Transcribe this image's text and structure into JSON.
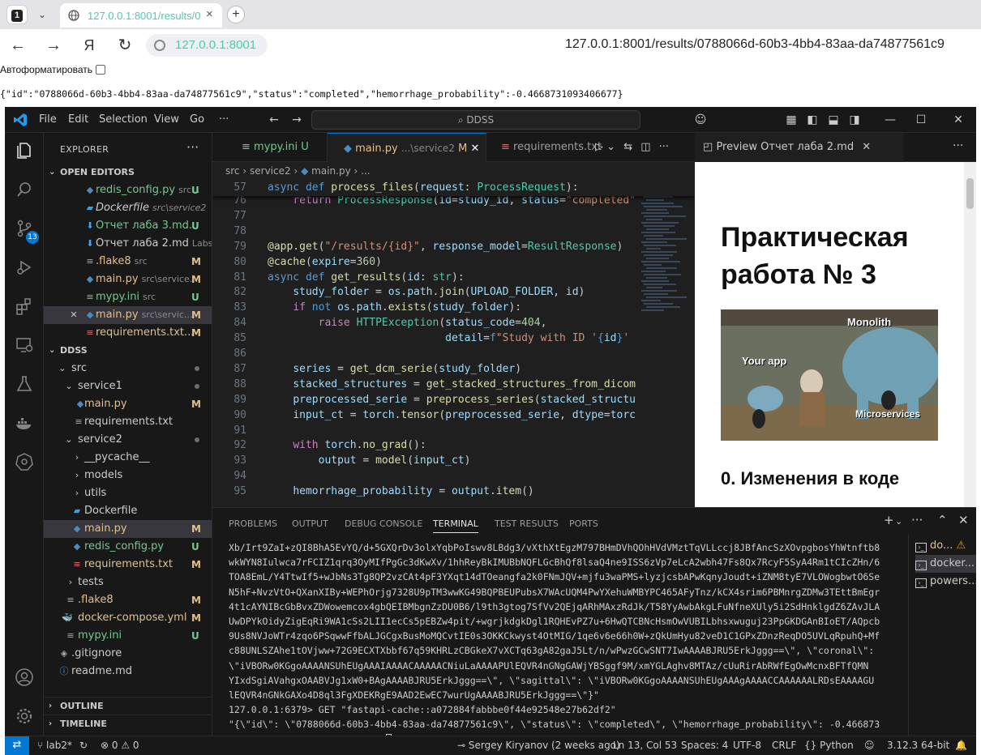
{
  "browser": {
    "tab_count": "1",
    "tab_title": "127.0.0.1:8001/results/0",
    "address_short": "127.0.0.1:8001",
    "full_url": "127.0.0.1:8001/results/0788066d-60b3-4bb4-83aa-da74877561c9",
    "yandex_glyph": "Я"
  },
  "page": {
    "autoformat_label": "Автоформатировать",
    "json_text": "{\"id\":\"0788066d-60b3-4bb4-83aa-da74877561c9\",\"status\":\"completed\",\"hemorrhage_probability\":-0.4668731093406677}"
  },
  "vscode": {
    "menu": [
      "File",
      "Edit",
      "Selection",
      "View",
      "Go",
      "···"
    ],
    "search_text": "DDSS",
    "activity_badge": "13",
    "explorer": {
      "title": "EXPLORER",
      "open_editors_label": "OPEN EDITORS",
      "open_editors": [
        {
          "name": "redis_config.py",
          "sub": "src...",
          "status": "U"
        },
        {
          "name": "Dockerfile",
          "sub": "src\\service2",
          "status": ""
        },
        {
          "name": "Отчет лаба 3.md...",
          "sub": "",
          "status": "U"
        },
        {
          "name": "Отчет лаба 2.md",
          "sub": "Labs\\...",
          "status": ""
        },
        {
          "name": ".flake8",
          "sub": "src",
          "status": "M"
        },
        {
          "name": "main.py",
          "sub": "src\\service...",
          "status": "M"
        },
        {
          "name": "mypy.ini",
          "sub": "src",
          "status": "U"
        },
        {
          "name": "main.py",
          "sub": "src\\servic...",
          "status": "M"
        },
        {
          "name": "requirements.txt...",
          "sub": "",
          "status": "M"
        }
      ],
      "workspace_label": "DDSS",
      "tree": [
        {
          "name": "src",
          "status": ""
        },
        {
          "name": "service1",
          "status": ""
        },
        {
          "name": "main.py",
          "status": "M"
        },
        {
          "name": "requirements.txt",
          "status": ""
        },
        {
          "name": "service2",
          "status": ""
        },
        {
          "name": "__pycache__",
          "status": ""
        },
        {
          "name": "models",
          "status": ""
        },
        {
          "name": "utils",
          "status": ""
        },
        {
          "name": "Dockerfile",
          "status": ""
        },
        {
          "name": "main.py",
          "status": "M"
        },
        {
          "name": "redis_config.py",
          "status": "U"
        },
        {
          "name": "requirements.txt",
          "status": "M"
        },
        {
          "name": "tests",
          "status": ""
        },
        {
          "name": ".flake8",
          "status": "M"
        },
        {
          "name": "docker-compose.yml",
          "status": "M"
        },
        {
          "name": "mypy.ini",
          "status": "U"
        },
        {
          "name": ".gitignore",
          "status": ""
        },
        {
          "name": "readme.md",
          "status": ""
        }
      ],
      "outline_label": "OUTLINE",
      "timeline_label": "TIMELINE"
    },
    "editor_tabs": [
      {
        "name": "mypy.ini",
        "path": "",
        "status": "U"
      },
      {
        "name": "main.py",
        "path": "...\\service2",
        "status": "M"
      },
      {
        "name": "requirements.txt",
        "path": "",
        "status": ""
      }
    ],
    "breadcrumb": [
      "src",
      "service2",
      "main.py",
      "..."
    ],
    "code_lines": [
      {
        "n": "57",
        "html": "<span class='k'>async</span> <span class='k'>def</span> <span class='f'>process_files</span>(<span class='v'>request</span>: <span class='t'>ProcessRequest</span>):"
      },
      {
        "n": "76",
        "html": "    <span class='kc'>return</span> <span class='t'>ProcessResponse</span>(<span class='v'>id</span>=<span class='v'>study_id</span>, <span class='v'>status</span>=<span class='s'>\"completed\"</span>"
      },
      {
        "n": "77",
        "html": ""
      },
      {
        "n": "78",
        "html": ""
      },
      {
        "n": "79",
        "html": "<span class='dec'>@app.get</span>(<span class='s'>\"/results/{id}\"</span>, <span class='v'>response_model</span>=<span class='t'>ResultResponse</span>)"
      },
      {
        "n": "80",
        "html": "<span class='dec'>@cache</span>(<span class='v'>expire</span>=<span class='n'>360</span>)"
      },
      {
        "n": "81",
        "html": "<span class='k'>async</span> <span class='k'>def</span> <span class='f'>get_results</span>(<span class='v'>id</span>: <span class='t'>str</span>):"
      },
      {
        "n": "82",
        "html": "    <span class='v'>study_folder</span> = <span class='v'>os</span>.<span class='v'>path</span>.<span class='f'>join</span>(<span class='v'>UPLOAD_FOLDER</span>, <span class='v'>id</span>)"
      },
      {
        "n": "83",
        "html": "    <span class='kc'>if</span> <span class='k'>not</span> <span class='v'>os</span>.<span class='v'>path</span>.<span class='f'>exists</span>(<span class='v'>study_folder</span>):"
      },
      {
        "n": "84",
        "html": "        <span class='kc'>raise</span> <span class='t'>HTTPException</span>(<span class='v'>status_code</span>=<span class='n'>404</span>,"
      },
      {
        "n": "85",
        "html": "                            <span class='v'>detail</span>=<span class='k'>f</span><span class='s'>\"Study with ID '</span><span class='k'>{</span><span class='v'>id</span><span class='k'>}</span><span class='s'>'</span>"
      },
      {
        "n": "86",
        "html": ""
      },
      {
        "n": "87",
        "html": "    <span class='v'>series</span> = <span class='f'>get_dcm_serie</span>(<span class='v'>study_folder</span>)"
      },
      {
        "n": "88",
        "html": "    <span class='v'>stacked_structures</span> = <span class='f'>get_stacked_structures_from_dicom</span>"
      },
      {
        "n": "89",
        "html": "    <span class='v'>preprocessed_serie</span> = <span class='f'>preprocess_series</span>(<span class='v'>stacked_structu</span>"
      },
      {
        "n": "90",
        "html": "    <span class='v'>input_ct</span> = <span class='v'>torch</span>.<span class='f'>tensor</span>(<span class='v'>preprocessed_serie</span>, <span class='v'>dtype</span>=<span class='v'>torc</span>"
      },
      {
        "n": "91",
        "html": ""
      },
      {
        "n": "92",
        "html": "    <span class='kc'>with</span> <span class='v'>torch</span>.<span class='f'>no_grad</span>():"
      },
      {
        "n": "93",
        "html": "        <span class='v'>output</span> = <span class='f'>model</span>(<span class='v'>input_ct</span>)"
      },
      {
        "n": "94",
        "html": ""
      },
      {
        "n": "95",
        "html": "    <span class='v'>hemorrhage_probability</span> = <span class='v'>output</span>.<span class='f'>item</span>()"
      }
    ],
    "preview": {
      "tab_title": "Preview Отчет лаба 2.md",
      "heading": "Практическая работа № 3",
      "meme_labels": [
        "Monolith",
        "Your app",
        "Microservices"
      ],
      "section_heading": "0. Изменения в коде"
    },
    "panel": {
      "tabs": [
        "PROBLEMS",
        "OUTPUT",
        "DEBUG CONSOLE",
        "TERMINAL",
        "TEST RESULTS",
        "PORTS"
      ],
      "active_tab": "TERMINAL",
      "terminal_lines": [
        "Xb/Irt9ZaI+zQI8BhA5EvYQ/d+5GXQrDv3olxYqbPoIswv8LBdg3/vXthXtEgzM797BHmDVhQOhHVdVMztTqVLLccj8JBfAncSzXOvpgbosYhWtnftb8",
        "wkWYN8Iulwca7rFCIZ1qrq3OyMIfPgGc3dKwXv/1hhReyBkIMUBbNQFLGcBhQf8lsaQ4ne9ISS6zVp7eLcA2wbh47Fs8Qx7RcyF5SyA4Rm1tCIcZHn/6",
        "TOA8EmL/Y4TtwIf5+wJbNs3Tg8QP2vzCAt4pF3YXqt14dTOeangfa2k0FNmJQV+mjfu3waPMS+lyzjcsbAPwKqnyJoudt+iZNM8tyE7VLOWogbwtO6Se",
        "N5hF+NvzVtO+QXanXIBy+WEPhOrjg7328U9pTM3wwKG49BQPBEUPubsX7WAcUQM4PwYXehuWMBYPC465AFyTnz/kCX4srim6PBMnrgZDMw3TEttBmEgr",
        "4t1cAYNIBcGbBvxZDWowemcox4gbQEIBMbgnZzDU0B6/l9th3gtog7SfVv2QEjqARhMAxzRdJk/T58YyAwbAkgLFuNfneXUly5i2SdHnklgdZ6ZAvJLA",
        "UwDPYkOidyZigEqRi9WA1cSs2LII1ecCs5pEBZw4pit/+wgrjkdgkDgl1RQHEvPZ7u+6HwQTCBNcHsmOwVUBILbhsxwuguj23PpGKDGAnBIoET/AQpcb",
        "9Us8NVJoWTr4zqo6PSqwwFfbALJGCgxBusMoMQCvtIE0s3OKKCkwyst4OtMIG/1qe6v6e66h0W+zQkUmHyu82veD1C1GPxZDnzReqDO5UVLqRpuhQ+Mf",
        "c88UNLSZAhe1tOVjww+72G9ECXTXbbf67q59KHRLzCBGkeX7vXCTq63gA82gaJ5Lt/n/wPwzGCwSNT7IwAAAABJRU5ErkJggg==\\\", \\\"coronal\\\":",
        "\\\"iVBORw0KGgoAAAANSUhEUgAAAIAAAACAAAAACNiuLaAAAAPUlEQVR4nGNgGAWjYBSggf9M/xmYGLAghv8MTAz/cUuRirAbRWfEgOwMcnxBFTfQMN",
        "YIxdSgiAVahgxOAABVJg1xW0+BAgAAAABJRU5ErkJggg==\\\", \\\"sagittal\\\": \\\"iVBORw0KGgoAAAANSUhEUgAAAgAAAACCAAAAAALRDsEAAAAGU",
        "lEQVR4nGNkGAXo4D8ql3FgXDEKRgE9AAD2EwEC7wurUgAAAABJRU5ErkJggg==\\\"}\"",
        "127.0.0.1:6379> GET \"fastapi-cache::a072884fabbbe0f44e92548e27b62df2\"",
        "\"{\\\"id\\\": \\\"0788066d-60b3-4bb4-83aa-da74877561c9\\\", \\\"status\\\": \\\"completed\\\", \\\"hemorrhage_probability\\\": -0.466873",
        "1093406677}\"127.0.0.1:6379> "
      ],
      "terminals": [
        "do...",
        "docker...",
        "powers..."
      ]
    },
    "status": {
      "branch": "lab2*",
      "problems": "⊗ 0 ⚠ 0",
      "blame": "Sergey Kiryanov (2 weeks ago)",
      "cursor": "Ln 13, Col 53",
      "spaces": "Spaces: 4",
      "encoding": "UTF-8",
      "eol": "CRLF",
      "language": "Python",
      "python_version": "3.12.3 64-bit"
    }
  }
}
